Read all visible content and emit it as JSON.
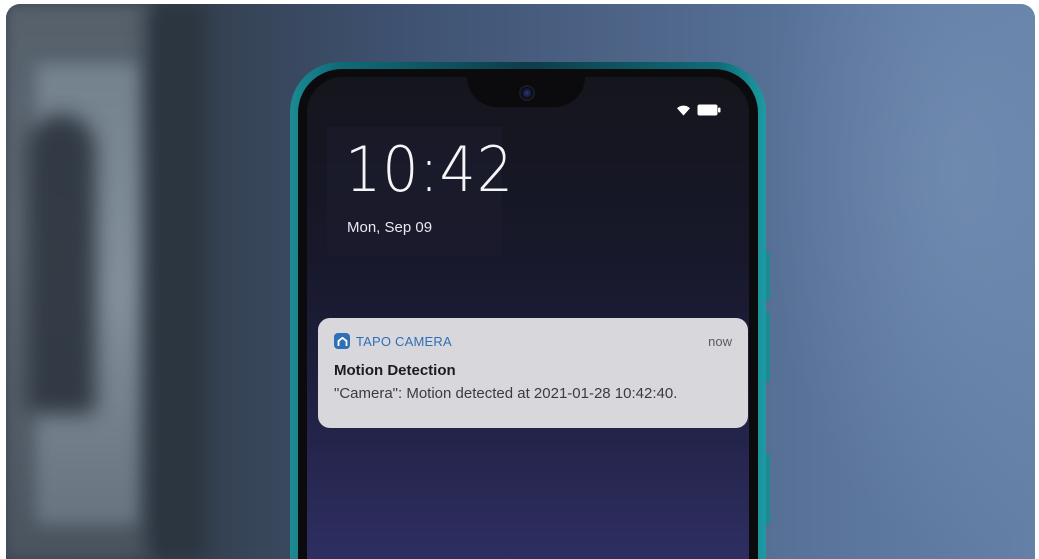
{
  "lockscreen": {
    "time": "10:42",
    "date": "Mon, Sep 09"
  },
  "status_bar": {
    "icons": [
      "wifi-icon",
      "battery-icon"
    ]
  },
  "notification": {
    "app_name": "TAPO CAMERA",
    "timestamp": "now",
    "title": "Motion Detection",
    "body": "\"Camera\": Motion detected at 2021-01-28 10:42:40.",
    "app_icon": "tapo-home-icon"
  },
  "colors": {
    "accent": "#2f6fb5",
    "phone_frame": "#1a8b93",
    "notification_bg": "#d8d8dc"
  }
}
